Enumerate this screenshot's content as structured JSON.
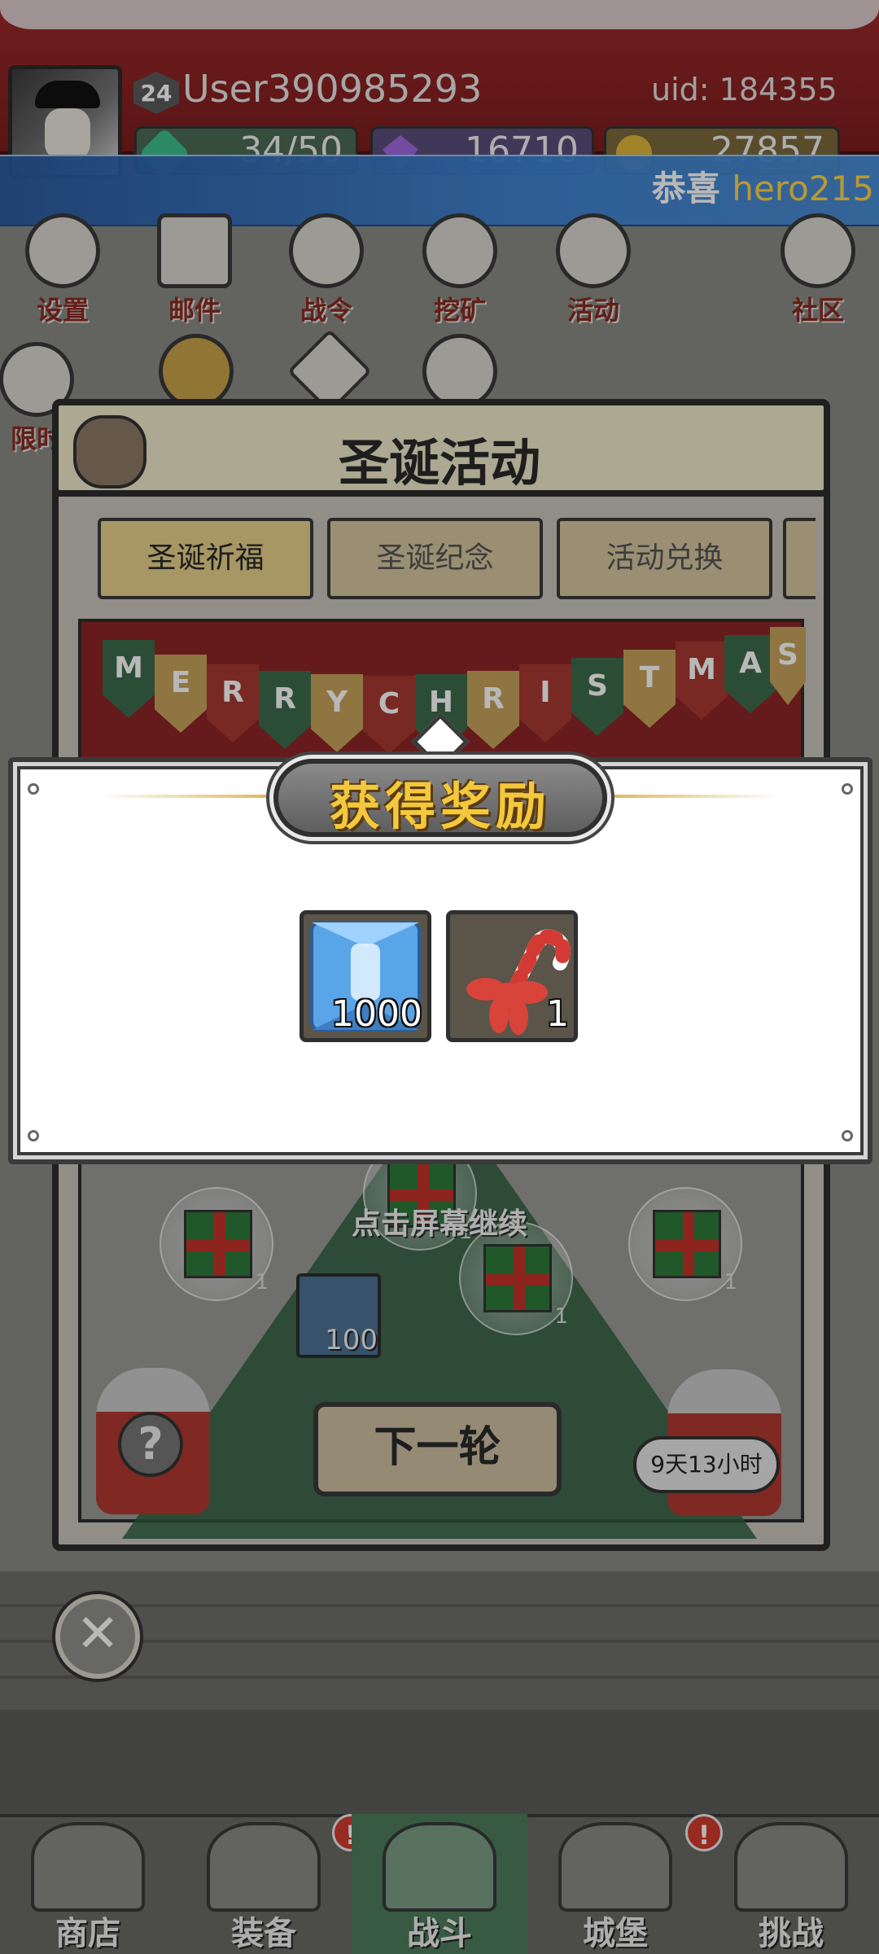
{
  "header": {
    "level": "24",
    "username": "User390985293",
    "uid": "uid: 184355",
    "resources": {
      "energy": "34/50",
      "gems": "16710",
      "gold": "27857"
    }
  },
  "broadcast": {
    "prefix": "恭喜",
    "highlight": "hero215"
  },
  "menu": {
    "settings": "设置",
    "mail": "邮件",
    "battle_pass": "战令",
    "mining": "挖矿",
    "events": "活动",
    "community": "社区",
    "limited": "限时"
  },
  "event_panel": {
    "title": "圣诞活动",
    "tabs": [
      {
        "label": "圣诞祈福",
        "active": true
      },
      {
        "label": "圣诞纪念",
        "active": false
      },
      {
        "label": "活动兑换",
        "active": false
      }
    ],
    "garland_letters": [
      "M",
      "E",
      "R",
      "R",
      "Y",
      "C",
      "H",
      "R",
      "I",
      "S",
      "T",
      "M",
      "A",
      "S"
    ],
    "hint": "点击屏幕继续",
    "scene_items": [
      {
        "name": "gift",
        "count": "1"
      },
      {
        "name": "gift",
        "count": "1"
      },
      {
        "name": "gift",
        "count": "1"
      },
      {
        "name": "gift",
        "count": "1"
      },
      {
        "name": "feather",
        "count": "100"
      }
    ],
    "next_round_label": "下一轮",
    "timer": "9天13小时",
    "mystery_symbol": "?"
  },
  "reward_modal": {
    "title": "获得奖励",
    "items": [
      {
        "icon": "ice-crystal-icon",
        "count": "1000"
      },
      {
        "icon": "candy-cane-icon",
        "count": "1"
      }
    ]
  },
  "bottom_nav": {
    "items": [
      {
        "label": "商店",
        "alert": false
      },
      {
        "label": "装备",
        "alert": true
      },
      {
        "label": "战斗",
        "alert": false,
        "active": true
      },
      {
        "label": "城堡",
        "alert": true
      },
      {
        "label": "挑战",
        "alert": false
      }
    ],
    "alert_symbol": "!"
  },
  "close_symbol": "✕",
  "colors": {
    "accent_gold": "#f3c83c",
    "brand_red": "#9e2a2a",
    "banner_blue": "#3c82d2",
    "active_green": "#4e7d5c"
  }
}
